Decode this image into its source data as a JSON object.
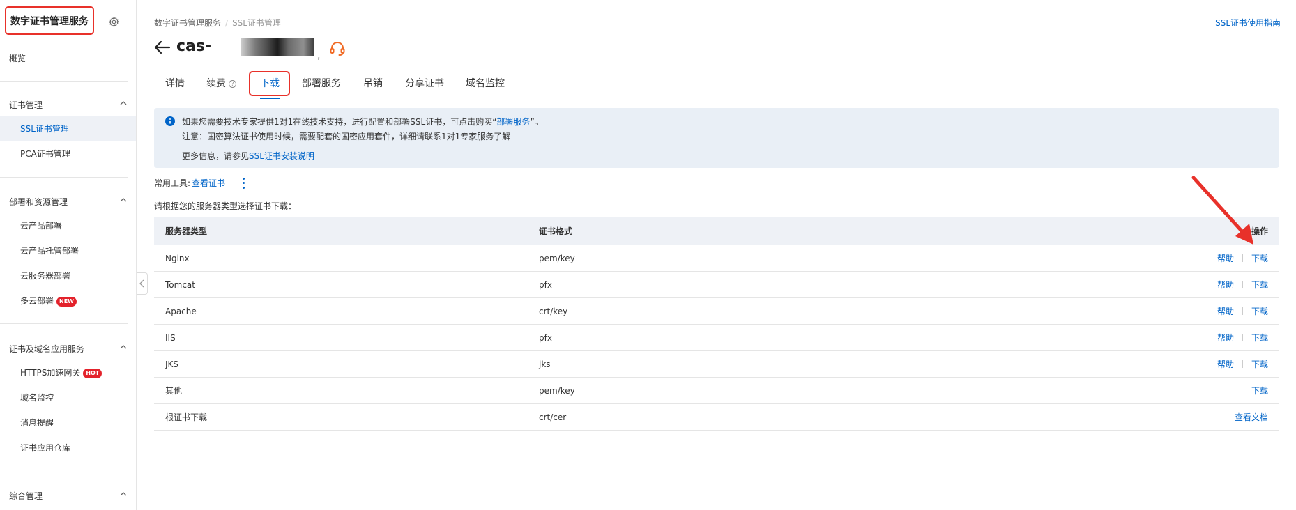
{
  "sidebar": {
    "brand": "数字证书管理服务",
    "overview": "概览",
    "groups": [
      {
        "label": "证书管理",
        "items": [
          {
            "label": "SSL证书管理",
            "active": true
          },
          {
            "label": "PCA证书管理"
          }
        ]
      },
      {
        "label": "部署和资源管理",
        "items": [
          {
            "label": "云产品部署"
          },
          {
            "label": "云产品托管部署"
          },
          {
            "label": "云服务器部署"
          },
          {
            "label": "多云部署",
            "badge": "NEW"
          }
        ]
      },
      {
        "label": "证书及域名应用服务",
        "items": [
          {
            "label": "HTTPS加速网关",
            "badge": "HOT"
          },
          {
            "label": "域名监控"
          },
          {
            "label": "消息提醒"
          },
          {
            "label": "证书应用仓库"
          }
        ]
      },
      {
        "label": "综合管理",
        "items": []
      }
    ]
  },
  "header": {
    "breadcrumb": [
      "数字证书管理服务",
      "SSL证书管理"
    ],
    "guide_link": "SSL证书使用指南",
    "title": "cas-",
    "title_mark": ","
  },
  "tabs": [
    {
      "label": "详情"
    },
    {
      "label": "续费",
      "help": "?"
    },
    {
      "label": "下载",
      "active": true
    },
    {
      "label": "部署服务"
    },
    {
      "label": "吊销"
    },
    {
      "label": "分享证书"
    },
    {
      "label": "域名监控"
    }
  ],
  "notice": {
    "line1_pre": "如果您需要技术专家提供1对1在线技术支持，进行配置和部署SSL证书，可点击购买“",
    "line1_link": "部署服务",
    "line1_post": "”。",
    "line2": "注意：国密算法证书使用时候，需要配套的国密应用套件，详细请联系1对1专家服务了解",
    "line3_pre": "更多信息，请参见",
    "line3_link": "SSL证书安装说明"
  },
  "tools": {
    "label": "常用工具:",
    "link": "查看证书"
  },
  "instruction": "请根据您的服务器类型选择证书下载：",
  "table": {
    "headers": {
      "server": "服务器类型",
      "format": "证书格式",
      "action": "操作"
    },
    "rows": [
      {
        "server": "Nginx",
        "format": "pem/key",
        "actions": [
          "帮助",
          "下载"
        ]
      },
      {
        "server": "Tomcat",
        "format": "pfx",
        "actions": [
          "帮助",
          "下载"
        ]
      },
      {
        "server": "Apache",
        "format": "crt/key",
        "actions": [
          "帮助",
          "下载"
        ]
      },
      {
        "server": "IIS",
        "format": "pfx",
        "actions": [
          "帮助",
          "下载"
        ]
      },
      {
        "server": "JKS",
        "format": "jks",
        "actions": [
          "帮助",
          "下载"
        ]
      },
      {
        "server": "其他",
        "format": "pem/key",
        "actions": [
          "下载"
        ]
      },
      {
        "server": "根证书下载",
        "format": "crt/cer",
        "actions": [
          "查看文档"
        ]
      }
    ]
  },
  "colors": {
    "accent": "#0064c8",
    "annotation_red": "#e8312a",
    "notice_bg": "#e9eff6",
    "active_item_bg": "#eef1f6"
  }
}
